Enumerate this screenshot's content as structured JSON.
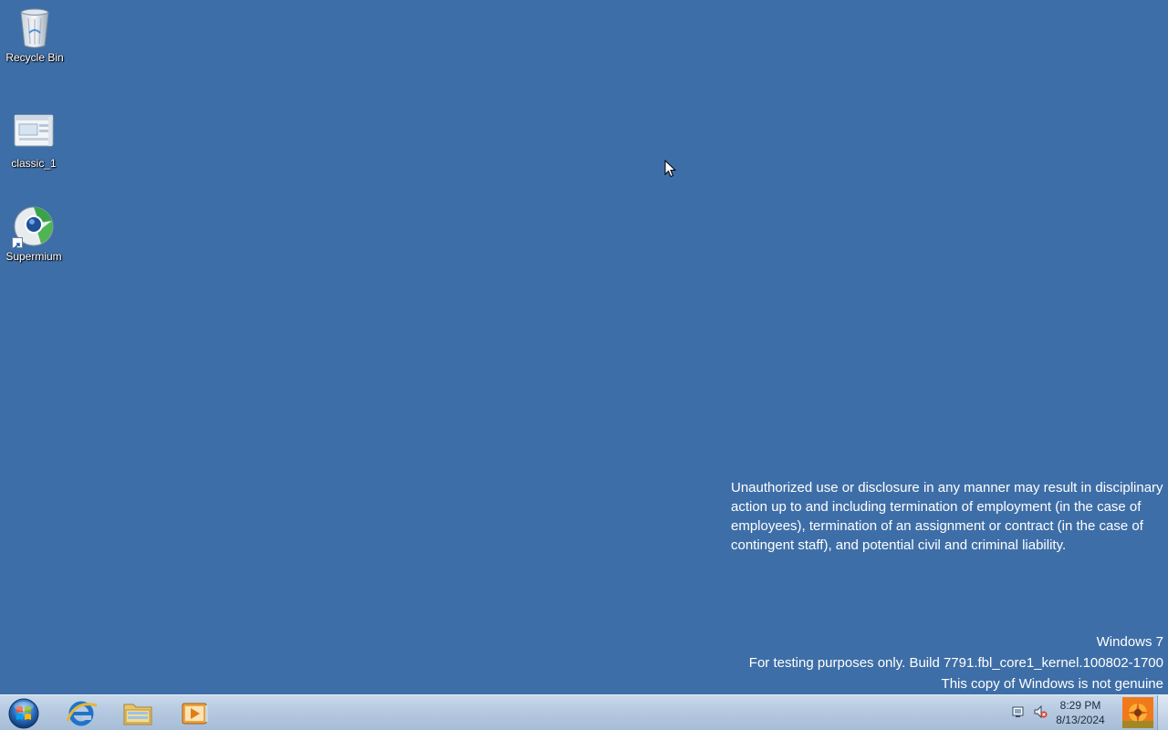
{
  "desktop": {
    "background_color": "#3e6ea7",
    "icons": [
      {
        "label": "Recycle Bin",
        "icon": "recycle-bin-icon"
      },
      {
        "label": "classic_1",
        "icon": "document-window-icon"
      },
      {
        "label": "Supermium",
        "icon": "supermium-browser-icon"
      }
    ],
    "warning_text": "Unauthorized use or disclosure in any manner may result in disciplinary action up to and including termination of employment (in the case of employees), termination of an assignment or contract (in the case of contingent staff), and potential civil and criminal liability.",
    "watermark": {
      "line1": "Windows 7",
      "line2": "For testing purposes only. Build 7791.fbl_core1_kernel.100802-1700",
      "line3": "This copy of Windows is not genuine"
    }
  },
  "taskbar": {
    "start_icon": "windows-start-orb-icon",
    "pinned": [
      {
        "name": "Internet Explorer",
        "icon": "internet-explorer-icon"
      },
      {
        "name": "Windows Explorer",
        "icon": "folder-explorer-icon"
      },
      {
        "name": "Windows Media Player",
        "icon": "media-player-icon"
      }
    ],
    "tray": {
      "icons": [
        "action-center-flag-icon",
        "volume-muted-icon"
      ],
      "time": "8:29 PM",
      "date": "8/13/2024"
    }
  }
}
